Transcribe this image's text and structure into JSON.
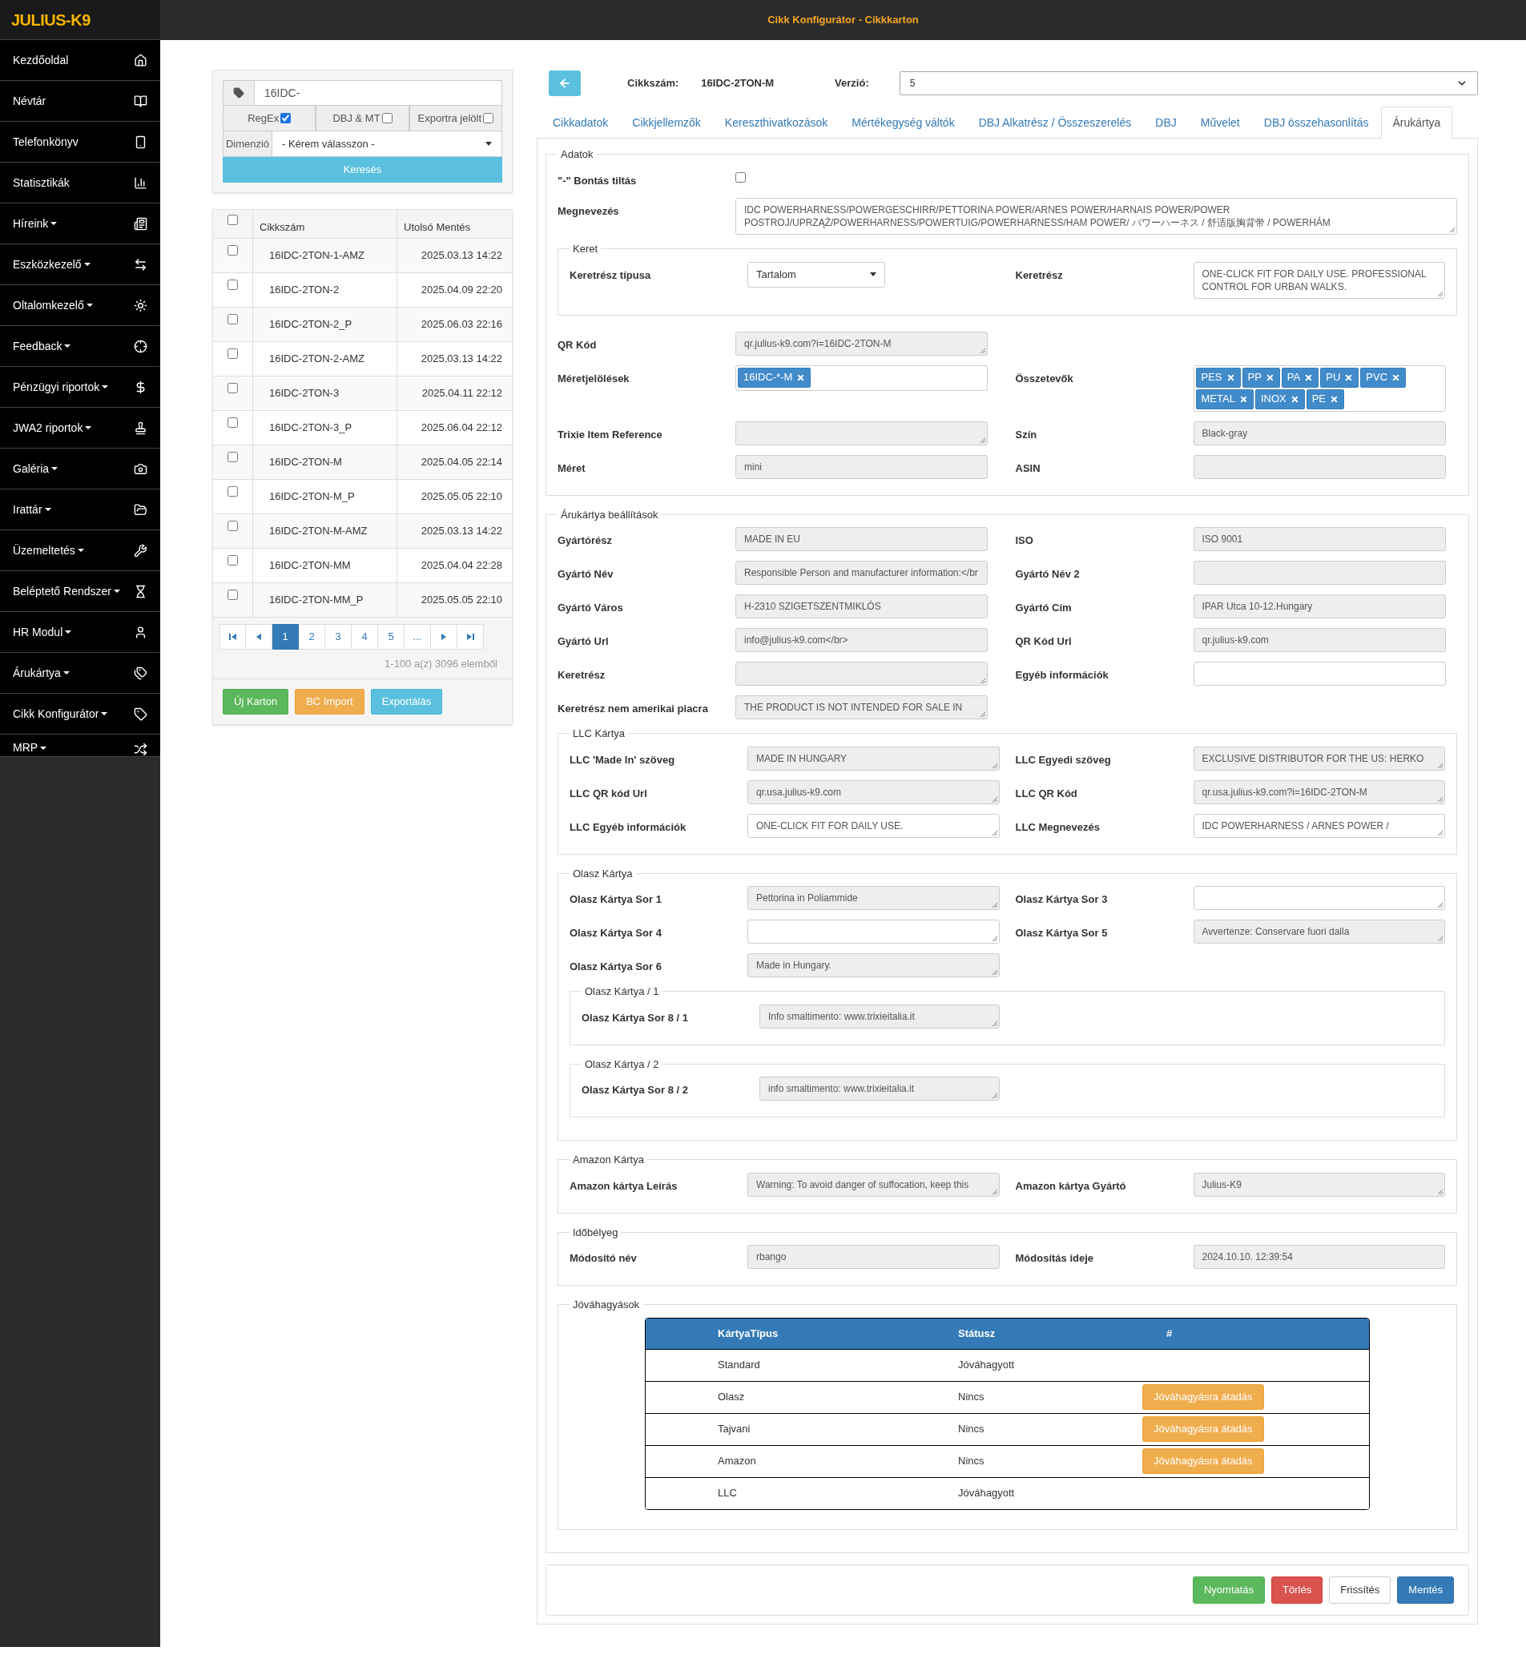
{
  "app": {
    "logo": "JULIUS-K9",
    "title": "Cikk Konfigurátor - Cikkkarton"
  },
  "sidebar": {
    "items": [
      {
        "label": "Kezdőoldal",
        "dropdown": false
      },
      {
        "label": "Névtár",
        "dropdown": false
      },
      {
        "label": "Telefonkönyv",
        "dropdown": false
      },
      {
        "label": "Statisztikák",
        "dropdown": false
      },
      {
        "label": "Híreink",
        "dropdown": true
      },
      {
        "label": "Eszközkezelő",
        "dropdown": true
      },
      {
        "label": "Oltalomkezelő",
        "dropdown": true
      },
      {
        "label": "Feedback",
        "dropdown": true
      },
      {
        "label": "Pénzügyi riportok",
        "dropdown": true
      },
      {
        "label": "JWA2 riportok",
        "dropdown": true
      },
      {
        "label": "Galéria",
        "dropdown": true
      },
      {
        "label": "Irattár",
        "dropdown": true
      },
      {
        "label": "Üzemeltetés",
        "dropdown": true
      },
      {
        "label": "Beléptető Rendszer",
        "dropdown": true
      },
      {
        "label": "HR Modul",
        "dropdown": true
      },
      {
        "label": "Árukártya",
        "dropdown": true
      },
      {
        "label": "Cikk Konfigurátor",
        "dropdown": true
      },
      {
        "label": "MRP",
        "dropdown": true
      }
    ]
  },
  "search": {
    "value": "16IDC-",
    "filters": [
      {
        "label": "RegEx",
        "checked": true
      },
      {
        "label": "DBJ & MT",
        "checked": false
      },
      {
        "label": "Exportra jelölt",
        "checked": false
      }
    ],
    "dimension": {
      "label": "Dimenzió",
      "value": "- Kérem válasszon -"
    },
    "button": "Keresés"
  },
  "list": {
    "all_checked": false,
    "columns": [
      "Cikkszám",
      "Utolsó Mentés"
    ],
    "rows": [
      {
        "code": "16IDC-2TON-1-AMZ",
        "saved": "2025.03.13 14:22",
        "checked": false
      },
      {
        "code": "16IDC-2TON-2",
        "saved": "2025.04.09 22:20",
        "checked": false
      },
      {
        "code": "16IDC-2TON-2_P",
        "saved": "2025.06.03 22:16",
        "checked": false
      },
      {
        "code": "16IDC-2TON-2-AMZ",
        "saved": "2025.03.13 14:22",
        "checked": false
      },
      {
        "code": "16IDC-2TON-3",
        "saved": "2025.04.11 22:12",
        "checked": false
      },
      {
        "code": "16IDC-2TON-3_P",
        "saved": "2025.06.04 22:12",
        "checked": false
      },
      {
        "code": "16IDC-2TON-M",
        "saved": "2025.04.05 22:14",
        "checked": false
      },
      {
        "code": "16IDC-2TON-M_P",
        "saved": "2025.05.05 22:10",
        "checked": false
      },
      {
        "code": "16IDC-2TON-M-AMZ",
        "saved": "2025.03.13 14:22",
        "checked": false
      },
      {
        "code": "16IDC-2TON-MM",
        "saved": "2025.04.04 22:28",
        "checked": false
      },
      {
        "code": "16IDC-2TON-MM_P",
        "saved": "2025.05.05 22:10",
        "checked": false
      }
    ],
    "pages": [
      {
        "label": "1",
        "selected": true
      },
      {
        "label": "2",
        "selected": false
      },
      {
        "label": "3",
        "selected": false
      },
      {
        "label": "4",
        "selected": false
      },
      {
        "label": "5",
        "selected": false
      },
      {
        "label": "...",
        "selected": false
      }
    ],
    "summary": "1-100 a(z) 3096 elemből",
    "buttons": [
      {
        "label": "Új Karton",
        "kind": "success"
      },
      {
        "label": "BC Import",
        "kind": "warning"
      },
      {
        "label": "Exportálás",
        "kind": "info"
      }
    ]
  },
  "header": {
    "item_label": "Cikkszám:",
    "item_value": "16IDC-2TON-M",
    "version_label": "Verzió:",
    "version_value": "5"
  },
  "tabs": [
    {
      "label": "Cikkadatok",
      "selected": false
    },
    {
      "label": "Cikkjellemzők",
      "selected": false
    },
    {
      "label": "Kereszthivatkozások",
      "selected": false
    },
    {
      "label": "Mértékegység váltók",
      "selected": false
    },
    {
      "label": "DBJ Alkatrész / Összeszerelés",
      "selected": false
    },
    {
      "label": "DBJ",
      "selected": false
    },
    {
      "label": "Művelet",
      "selected": false
    },
    {
      "label": "DBJ összehasonlítás",
      "selected": false
    },
    {
      "label": "Árukártya",
      "selected": true
    }
  ],
  "sections": [
    {
      "legend": "Adatok",
      "content": [
        {
          "kind": "row",
          "fields": [
            {
              "label": "\"-\" Bontás tiltás",
              "kind": "checkbox",
              "checked": false
            }
          ]
        },
        {
          "kind": "wide_row",
          "fields": [
            {
              "label": "Megnevezés",
              "kind": "textarea",
              "disabled": false,
              "value": "IDC POWERHARNESS/POWERGESCHIRR/PETTORINA POWER/ARNES POWER/HARNAIS POWER/POWER POSTROJ/UPRZĄŻ/POWERHARNESS/POWERTUIG/POWERHARNESS/HAM POWER/ パワーハーネス / 舒适版胸背带 / POWERHÁM"
            }
          ]
        },
        {
          "kind": "fieldset",
          "legend": "Keret",
          "content": [
            {
              "kind": "row",
              "fields": [
                {
                  "label": "Keretrész típusa",
                  "kind": "select",
                  "value": "Tartalom"
                },
                {
                  "label": "Keretrész",
                  "kind": "textarea",
                  "disabled": false,
                  "value": "ONE-CLICK FIT FOR DAILY USE. PROFESSIONAL CONTROL FOR URBAN WALKS."
                }
              ]
            }
          ]
        },
        {
          "kind": "row",
          "fields": [
            {
              "label": "QR Kód",
              "kind": "textarea",
              "disabled": true,
              "value": "qr.julius-k9.com?i=16IDC-2TON-M"
            }
          ]
        },
        {
          "kind": "row",
          "fields": [
            {
              "label": "Méretjelölések",
              "kind": "tags",
              "tags": [
                "16IDC-*-M"
              ]
            },
            {
              "label": "Összetevők",
              "kind": "tags",
              "tags": [
                "PES",
                "PP",
                "PA",
                "PU",
                "PVC",
                "METAL",
                "INOX",
                "PE"
              ]
            }
          ]
        },
        {
          "kind": "row",
          "fields": [
            {
              "label": "Trixie Item Reference",
              "kind": "textarea",
              "disabled": true
            },
            {
              "label": "Szín",
              "kind": "text",
              "disabled": true,
              "value": "Black-gray"
            }
          ]
        },
        {
          "kind": "row",
          "fields": [
            {
              "label": "Méret",
              "kind": "text",
              "disabled": true,
              "value": "mini"
            },
            {
              "label": "ASIN",
              "kind": "text",
              "disabled": true
            }
          ]
        }
      ]
    },
    {
      "legend": "Árukártya beállítások",
      "content": [
        {
          "kind": "row",
          "fields": [
            {
              "label": "Gyártórész",
              "kind": "text",
              "disabled": true,
              "value": "MADE IN EU"
            },
            {
              "label": "ISO",
              "kind": "text",
              "disabled": true,
              "value": "ISO 9001"
            }
          ]
        },
        {
          "kind": "row",
          "fields": [
            {
              "label": "Gyártó Név",
              "kind": "text",
              "disabled": true,
              "value": "Responsible Person and manufacturer information:</br"
            },
            {
              "label": "Gyártó Név 2",
              "kind": "text",
              "disabled": true
            }
          ]
        },
        {
          "kind": "row",
          "fields": [
            {
              "label": "Gyártó Város",
              "kind": "text",
              "disabled": true,
              "value": "H-2310 SZIGETSZENTMIKLÓS"
            },
            {
              "label": "Gyártó Cím",
              "kind": "text",
              "disabled": true,
              "value": "IPAR Utca 10-12.Hungary"
            }
          ]
        },
        {
          "kind": "row",
          "fields": [
            {
              "label": "Gyártó Url",
              "kind": "text",
              "disabled": true,
              "value": "info@julius-k9.com</br>"
            },
            {
              "label": "QR Kód Url",
              "kind": "text",
              "disabled": true,
              "value": "qr.julius-k9.com"
            }
          ]
        },
        {
          "kind": "row",
          "fields": [
            {
              "label": "Keretrész",
              "kind": "textarea",
              "disabled": true
            },
            {
              "label": "Egyéb információk",
              "kind": "text",
              "disabled": false
            }
          ]
        },
        {
          "kind": "row",
          "fields": [
            {
              "label": "Keretrész nem amerikai piacra",
              "kind": "textarea",
              "disabled": true,
              "value": "THE PRODUCT IS NOT INTENDED FOR SALE IN"
            }
          ]
        },
        {
          "kind": "fieldset",
          "legend": "LLC Kártya",
          "content": [
            {
              "kind": "row",
              "fields": [
                {
                  "label": "LLC 'Made In' szöveg",
                  "kind": "textarea",
                  "disabled": true,
                  "value": "MADE IN HUNGARY"
                },
                {
                  "label": "LLC Egyedi szöveg",
                  "kind": "textarea",
                  "disabled": true,
                  "value": "EXCLUSIVE DISTRIBUTOR FOR THE US: HERKO"
                }
              ]
            },
            {
              "kind": "row",
              "fields": [
                {
                  "label": "LLC QR kód Url",
                  "kind": "textarea",
                  "disabled": true,
                  "value": "qr.usa.julius-k9.com"
                },
                {
                  "label": "LLC QR Kód",
                  "kind": "textarea",
                  "disabled": true,
                  "value": "qr.usa.julius-k9.com?i=16IDC-2TON-M"
                }
              ]
            },
            {
              "kind": "row",
              "fields": [
                {
                  "label": "LLC Egyéb információk",
                  "kind": "textarea",
                  "disabled": false,
                  "value": "ONE-CLICK FIT FOR DAILY USE."
                },
                {
                  "label": "LLC Megnevezés",
                  "kind": "textarea",
                  "disabled": false,
                  "value": "IDC POWERHARNESS / ARNES POWER /"
                }
              ]
            }
          ]
        },
        {
          "kind": "fieldset",
          "legend": "Olasz Kártya",
          "content": [
            {
              "kind": "row",
              "fields": [
                {
                  "label": "Olasz Kártya Sor 1",
                  "kind": "textarea",
                  "disabled": true,
                  "value": "Pettorina in Poliammide"
                },
                {
                  "label": "Olasz Kártya Sor 3",
                  "kind": "textarea",
                  "disabled": false
                }
              ]
            },
            {
              "kind": "row",
              "fields": [
                {
                  "label": "Olasz Kártya Sor 4",
                  "kind": "textarea",
                  "disabled": false
                },
                {
                  "label": "Olasz Kártya Sor 5",
                  "kind": "textarea",
                  "disabled": true,
                  "value": "Avvertenze: Conservare fuori dalla"
                }
              ]
            },
            {
              "kind": "row",
              "fields": [
                {
                  "label": "Olasz Kártya Sor 6",
                  "kind": "textarea",
                  "disabled": true,
                  "value": "Made in Hungary."
                }
              ]
            },
            {
              "kind": "fieldset",
              "legend": "Olasz Kártya / 1",
              "content": [
                {
                  "kind": "row",
                  "fields": [
                    {
                      "label": "Olasz Kártya Sor 8 / 1",
                      "kind": "textarea",
                      "disabled": true,
                      "value": "Info smaltimento: www.trixieitalia.it"
                    }
                  ]
                }
              ]
            },
            {
              "kind": "fieldset",
              "legend": "Olasz Kártya / 2",
              "content": [
                {
                  "kind": "row",
                  "fields": [
                    {
                      "label": "Olasz Kártya Sor 8 / 2",
                      "kind": "textarea",
                      "disabled": true,
                      "value": "info smaltimento: www.trixieitalia.it"
                    }
                  ]
                }
              ]
            }
          ]
        },
        {
          "kind": "fieldset",
          "legend": "Amazon Kártya",
          "content": [
            {
              "kind": "row",
              "fields": [
                {
                  "label": "Amazon kártya Leírás",
                  "kind": "textarea",
                  "disabled": true,
                  "value": "Warning: To avoid danger of suffocation, keep this"
                },
                {
                  "label": "Amazon kártya Gyártó",
                  "kind": "textarea",
                  "disabled": true,
                  "value": "Julius-K9"
                }
              ]
            }
          ]
        },
        {
          "kind": "fieldset",
          "legend": "Időbélyeg",
          "content": [
            {
              "kind": "row",
              "fields": [
                {
                  "label": "Módosító név",
                  "kind": "text",
                  "disabled": true,
                  "value": "rbango"
                },
                {
                  "label": "Módosítás ideje",
                  "kind": "text",
                  "disabled": true,
                  "value": "2024.10.10. 12:39:54"
                }
              ]
            }
          ]
        },
        {
          "kind": "fieldset",
          "legend": "Jóváhagyások",
          "content": [
            {
              "kind": "table",
              "columns": [
                "KártyaTípus",
                "Státusz",
                "#"
              ],
              "rows": [
                {
                  "type": "Standard",
                  "status": "Jóváhagyott"
                },
                {
                  "type": "Olasz",
                  "status": "Nincs",
                  "action": "Jóváhagyásra átadás"
                },
                {
                  "type": "Tajvani",
                  "status": "Nincs",
                  "action": "Jóváhagyásra átadás"
                },
                {
                  "type": "Amazon",
                  "status": "Nincs",
                  "action": "Jóváhagyásra átadás"
                },
                {
                  "type": "LLC",
                  "status": "Jóváhagyott"
                }
              ]
            }
          ]
        }
      ]
    }
  ],
  "footer_buttons": [
    {
      "label": "Nyomtatás",
      "kind": "success"
    },
    {
      "label": "Törlés",
      "kind": "danger"
    },
    {
      "label": "Frissítés",
      "kind": "default"
    },
    {
      "label": "Mentés",
      "kind": "primary"
    }
  ]
}
